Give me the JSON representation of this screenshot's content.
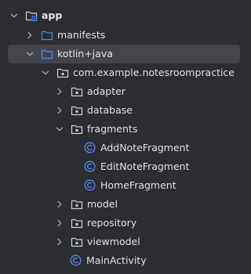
{
  "colors": {
    "background": "#2b2d30",
    "selected_row": "#43454a",
    "text": "#dfe1e5",
    "folder_blue": "#548af7",
    "folder_grey": "#ced0d6",
    "class_icon_blue": "#548af7",
    "chevron": "#9da0a8"
  },
  "tree": {
    "items": [
      {
        "label": "app",
        "icon": "module-folder-icon",
        "expanded": true,
        "bold": true
      },
      {
        "label": "manifests",
        "icon": "folder-icon",
        "expanded": false
      },
      {
        "label": "kotlin+java",
        "icon": "source-folder-icon",
        "expanded": true,
        "selected": true
      },
      {
        "label": "com.example.notesroompractice",
        "icon": "package-icon",
        "expanded": true
      },
      {
        "label": "adapter",
        "icon": "package-icon",
        "expanded": false
      },
      {
        "label": "database",
        "icon": "package-icon",
        "expanded": false
      },
      {
        "label": "fragments",
        "icon": "package-icon",
        "expanded": true
      },
      {
        "label": "AddNoteFragment",
        "icon": "kotlin-class-icon"
      },
      {
        "label": "EditNoteFragment",
        "icon": "kotlin-class-icon"
      },
      {
        "label": "HomeFragment",
        "icon": "kotlin-class-icon"
      },
      {
        "label": "model",
        "icon": "package-icon",
        "expanded": false
      },
      {
        "label": "repository",
        "icon": "package-icon",
        "expanded": false
      },
      {
        "label": "viewmodel",
        "icon": "package-icon",
        "expanded": false
      },
      {
        "label": "MainActivity",
        "icon": "kotlin-class-icon"
      }
    ]
  }
}
